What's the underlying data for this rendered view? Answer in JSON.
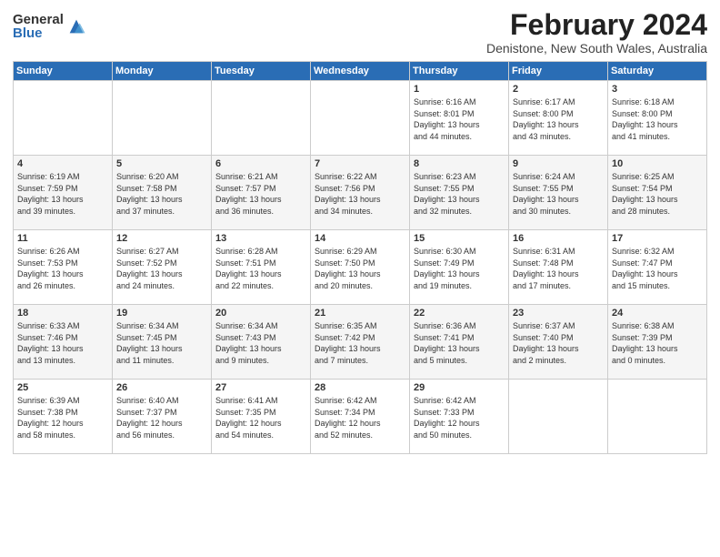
{
  "logo": {
    "general": "General",
    "blue": "Blue"
  },
  "title": "February 2024",
  "subtitle": "Denistone, New South Wales, Australia",
  "weekdays": [
    "Sunday",
    "Monday",
    "Tuesday",
    "Wednesday",
    "Thursday",
    "Friday",
    "Saturday"
  ],
  "weeks": [
    [
      {
        "day": "",
        "info": ""
      },
      {
        "day": "",
        "info": ""
      },
      {
        "day": "",
        "info": ""
      },
      {
        "day": "",
        "info": ""
      },
      {
        "day": "1",
        "info": "Sunrise: 6:16 AM\nSunset: 8:01 PM\nDaylight: 13 hours\nand 44 minutes."
      },
      {
        "day": "2",
        "info": "Sunrise: 6:17 AM\nSunset: 8:00 PM\nDaylight: 13 hours\nand 43 minutes."
      },
      {
        "day": "3",
        "info": "Sunrise: 6:18 AM\nSunset: 8:00 PM\nDaylight: 13 hours\nand 41 minutes."
      }
    ],
    [
      {
        "day": "4",
        "info": "Sunrise: 6:19 AM\nSunset: 7:59 PM\nDaylight: 13 hours\nand 39 minutes."
      },
      {
        "day": "5",
        "info": "Sunrise: 6:20 AM\nSunset: 7:58 PM\nDaylight: 13 hours\nand 37 minutes."
      },
      {
        "day": "6",
        "info": "Sunrise: 6:21 AM\nSunset: 7:57 PM\nDaylight: 13 hours\nand 36 minutes."
      },
      {
        "day": "7",
        "info": "Sunrise: 6:22 AM\nSunset: 7:56 PM\nDaylight: 13 hours\nand 34 minutes."
      },
      {
        "day": "8",
        "info": "Sunrise: 6:23 AM\nSunset: 7:55 PM\nDaylight: 13 hours\nand 32 minutes."
      },
      {
        "day": "9",
        "info": "Sunrise: 6:24 AM\nSunset: 7:55 PM\nDaylight: 13 hours\nand 30 minutes."
      },
      {
        "day": "10",
        "info": "Sunrise: 6:25 AM\nSunset: 7:54 PM\nDaylight: 13 hours\nand 28 minutes."
      }
    ],
    [
      {
        "day": "11",
        "info": "Sunrise: 6:26 AM\nSunset: 7:53 PM\nDaylight: 13 hours\nand 26 minutes."
      },
      {
        "day": "12",
        "info": "Sunrise: 6:27 AM\nSunset: 7:52 PM\nDaylight: 13 hours\nand 24 minutes."
      },
      {
        "day": "13",
        "info": "Sunrise: 6:28 AM\nSunset: 7:51 PM\nDaylight: 13 hours\nand 22 minutes."
      },
      {
        "day": "14",
        "info": "Sunrise: 6:29 AM\nSunset: 7:50 PM\nDaylight: 13 hours\nand 20 minutes."
      },
      {
        "day": "15",
        "info": "Sunrise: 6:30 AM\nSunset: 7:49 PM\nDaylight: 13 hours\nand 19 minutes."
      },
      {
        "day": "16",
        "info": "Sunrise: 6:31 AM\nSunset: 7:48 PM\nDaylight: 13 hours\nand 17 minutes."
      },
      {
        "day": "17",
        "info": "Sunrise: 6:32 AM\nSunset: 7:47 PM\nDaylight: 13 hours\nand 15 minutes."
      }
    ],
    [
      {
        "day": "18",
        "info": "Sunrise: 6:33 AM\nSunset: 7:46 PM\nDaylight: 13 hours\nand 13 minutes."
      },
      {
        "day": "19",
        "info": "Sunrise: 6:34 AM\nSunset: 7:45 PM\nDaylight: 13 hours\nand 11 minutes."
      },
      {
        "day": "20",
        "info": "Sunrise: 6:34 AM\nSunset: 7:43 PM\nDaylight: 13 hours\nand 9 minutes."
      },
      {
        "day": "21",
        "info": "Sunrise: 6:35 AM\nSunset: 7:42 PM\nDaylight: 13 hours\nand 7 minutes."
      },
      {
        "day": "22",
        "info": "Sunrise: 6:36 AM\nSunset: 7:41 PM\nDaylight: 13 hours\nand 5 minutes."
      },
      {
        "day": "23",
        "info": "Sunrise: 6:37 AM\nSunset: 7:40 PM\nDaylight: 13 hours\nand 2 minutes."
      },
      {
        "day": "24",
        "info": "Sunrise: 6:38 AM\nSunset: 7:39 PM\nDaylight: 13 hours\nand 0 minutes."
      }
    ],
    [
      {
        "day": "25",
        "info": "Sunrise: 6:39 AM\nSunset: 7:38 PM\nDaylight: 12 hours\nand 58 minutes."
      },
      {
        "day": "26",
        "info": "Sunrise: 6:40 AM\nSunset: 7:37 PM\nDaylight: 12 hours\nand 56 minutes."
      },
      {
        "day": "27",
        "info": "Sunrise: 6:41 AM\nSunset: 7:35 PM\nDaylight: 12 hours\nand 54 minutes."
      },
      {
        "day": "28",
        "info": "Sunrise: 6:42 AM\nSunset: 7:34 PM\nDaylight: 12 hours\nand 52 minutes."
      },
      {
        "day": "29",
        "info": "Sunrise: 6:42 AM\nSunset: 7:33 PM\nDaylight: 12 hours\nand 50 minutes."
      },
      {
        "day": "",
        "info": ""
      },
      {
        "day": "",
        "info": ""
      }
    ]
  ]
}
